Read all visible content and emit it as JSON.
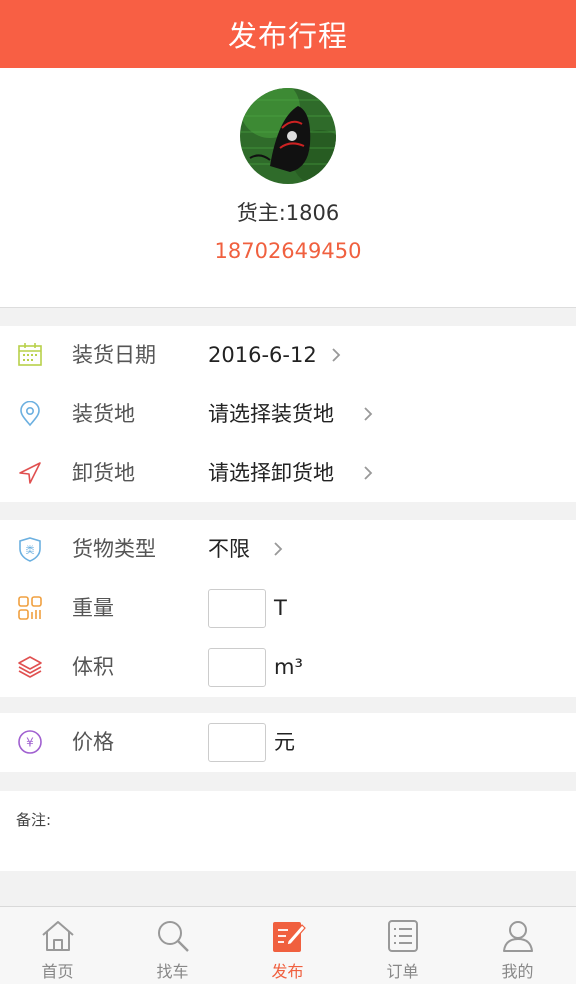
{
  "header": {
    "title": "发布行程"
  },
  "profile": {
    "owner_label": "货主:1806",
    "phone": "18702649450"
  },
  "form": {
    "load_date": {
      "label": "装货日期",
      "value": "2016-6-12"
    },
    "load_place": {
      "label": "装货地",
      "value": "请选择装货地"
    },
    "unload_place": {
      "label": "卸货地",
      "value": "请选择卸货地"
    },
    "cargo_type": {
      "label": "货物类型",
      "value": "不限"
    },
    "weight": {
      "label": "重量",
      "value": "",
      "unit": "T"
    },
    "volume": {
      "label": "体积",
      "value": "",
      "unit": "m³"
    },
    "price": {
      "label": "价格",
      "value": "",
      "unit": "元"
    },
    "remark": {
      "label": "备注:"
    }
  },
  "tabs": [
    {
      "label": "首页",
      "icon": "home-icon"
    },
    {
      "label": "找车",
      "icon": "search-icon"
    },
    {
      "label": "发布",
      "icon": "publish-icon",
      "active": true
    },
    {
      "label": "订单",
      "icon": "order-icon"
    },
    {
      "label": "我的",
      "icon": "user-icon"
    }
  ],
  "colors": {
    "brand": "#f85f44",
    "accent_text": "#f0603f",
    "background": "#f2f2f2"
  }
}
